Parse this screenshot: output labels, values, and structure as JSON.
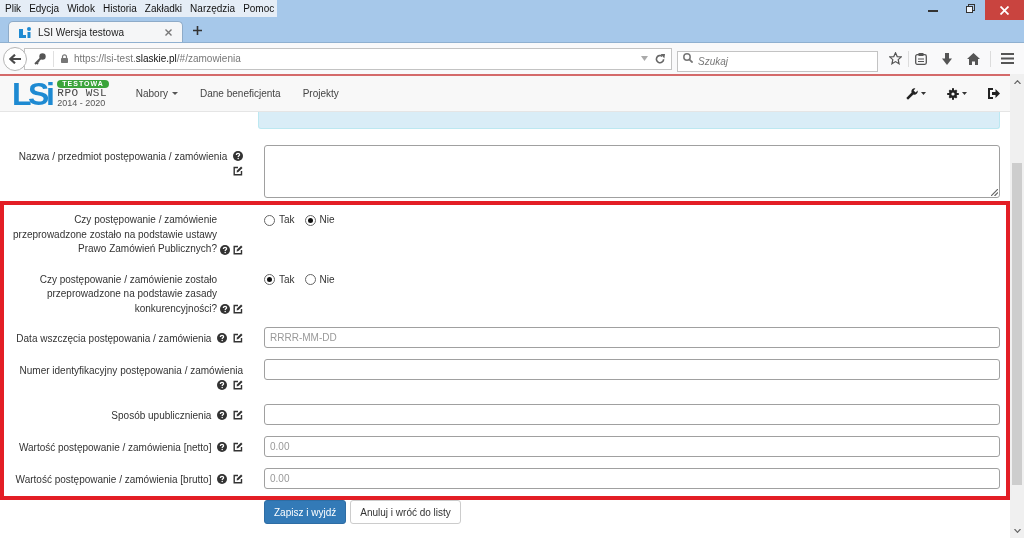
{
  "browser": {
    "menu": [
      "Plik",
      "Edycja",
      "Widok",
      "Historia",
      "Zakładki",
      "Narzędzia",
      "Pomoc"
    ],
    "tabs": [
      {
        "title": "LSI Wersja testowa",
        "selected": true
      }
    ],
    "address": {
      "prefix": "https://lsi-test.",
      "domain": "slaskie.pl",
      "path": "/#/zamowienia"
    },
    "search": {
      "placeholder": "Szukaj"
    }
  },
  "app_header": {
    "logo": {
      "mark": "LSi",
      "badge": "TESTOWA",
      "program": "RPO WSL",
      "years": "2014 - 2020"
    },
    "nav": [
      {
        "label": "Nabory",
        "dropdown": true
      },
      {
        "label": "Dane beneficjenta",
        "dropdown": false
      },
      {
        "label": "Projekty",
        "dropdown": false
      }
    ],
    "tools": [
      {
        "kind": "wrench",
        "dropdown": true
      },
      {
        "kind": "gear",
        "dropdown": true
      },
      {
        "kind": "logout",
        "dropdown": false
      }
    ]
  },
  "form": {
    "sections": [
      {
        "rows": [
          {
            "kind": "textarea",
            "label": "Nazwa / przedmiot postępowania / zamówienia"
          }
        ]
      },
      {
        "highlighted": true,
        "rows": [
          {
            "kind": "radio",
            "label": "Czy postępowanie / zamówienie przeprowadzone zostało na podstawie ustawy Prawo Zamówień Publicznych?",
            "options": [
              {
                "label": "Tak",
                "selected": false
              },
              {
                "label": "Nie",
                "selected": true
              }
            ]
          },
          {
            "kind": "radio",
            "label": "Czy postępowanie / zamówienie zostało przeprowadzone na podstawie zasady konkurencyjności?",
            "options": [
              {
                "label": "Tak",
                "selected": true
              },
              {
                "label": "Nie",
                "selected": false
              }
            ]
          },
          {
            "kind": "text",
            "label": "Data wszczęcia postępowania / zamówienia",
            "placeholder": "RRRR-MM-DD"
          },
          {
            "kind": "text",
            "label": "Numer identyfikacyjny postępowania / zamówienia"
          },
          {
            "kind": "text",
            "label": "Sposób upublicznienia"
          },
          {
            "kind": "text",
            "label": "Wartość postępowanie / zamówienia [netto]",
            "placeholder": "0.00"
          },
          {
            "kind": "text",
            "label": "Wartość postępowanie / zamówienia [brutto]",
            "placeholder": "0.00"
          }
        ]
      }
    ],
    "buttons": [
      {
        "label": "Zapisz i wyjdź",
        "kind": "primary"
      },
      {
        "label": "Anuluj i wróć do listy",
        "kind": "default"
      }
    ]
  }
}
